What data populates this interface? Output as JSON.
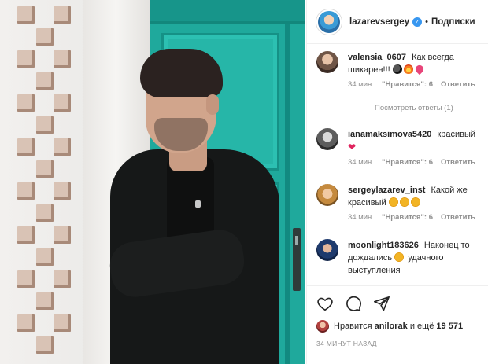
{
  "post": {
    "username": "lazarevsergey",
    "verified": true,
    "separator": "•",
    "follow_label": "Подписки"
  },
  "comments": [
    {
      "username": "valensia_0607",
      "text": "Как всегда шикарен!!!",
      "emojis": [
        "bomb",
        "fire",
        "heart-with-ribbon"
      ],
      "time": "34 мин.",
      "likes": "\"Нравится\": 6",
      "reply": "Ответить",
      "view_replies": "Посмотреть ответы (1)"
    },
    {
      "username": "ianamaksimova5420",
      "text": "красивый",
      "emojis": [
        "red-heart"
      ],
      "time": "34 мин.",
      "likes": "\"Нравится\": 6",
      "reply": "Ответить"
    },
    {
      "username": "sergeylazarev_inst",
      "text": "Какой же красивый",
      "emojis": [
        "heart-eyes",
        "heart-eyes",
        "heart-eyes"
      ],
      "time": "34 мин.",
      "likes": "\"Нравится\": 6",
      "reply": "Ответить"
    },
    {
      "username": "moonlight183626",
      "text_before": "Наконец то дождались",
      "text_after": "удачного выступления",
      "emojis": [
        "heart-eyes"
      ]
    }
  ],
  "actions": {
    "like_icon": "heart-outline-icon",
    "comment_icon": "comment-icon",
    "share_icon": "share-icon"
  },
  "likes": {
    "prefix": "Нравится",
    "user": "anilorak",
    "suffix": "и ещё",
    "count": "19 571"
  },
  "timestamp": "34 МИНУТ НАЗАД",
  "colors": {
    "door": "#1fa99c",
    "verified": "#3897f0",
    "muted": "#8e8e8e"
  }
}
